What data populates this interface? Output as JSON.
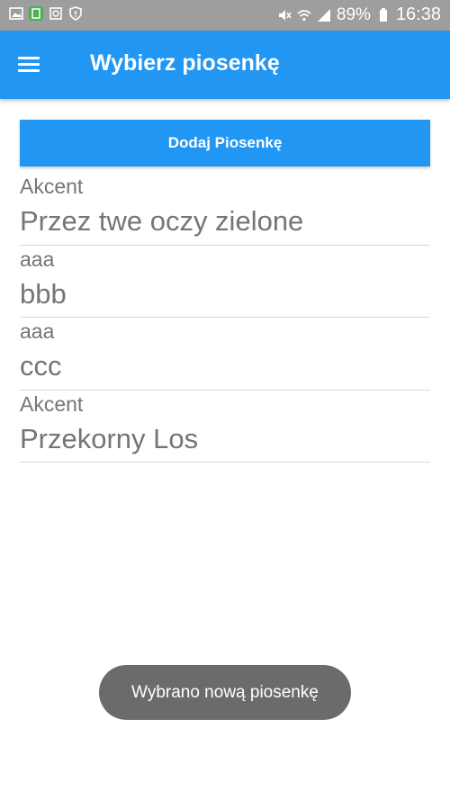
{
  "status_bar": {
    "left_icons": [
      "image-icon",
      "android-debug-icon",
      "recycle-icon",
      "shield-icon"
    ],
    "right_icons": [
      "mute-icon",
      "wifi-icon",
      "signal-icon"
    ],
    "battery": "89%",
    "time": "16:38"
  },
  "app_bar": {
    "menu_icon": "hamburger-menu-icon",
    "title": "Wybierz piosenkę"
  },
  "add_button_label": "Dodaj Piosenkę",
  "songs": [
    {
      "artist": "Akcent",
      "title": "Przez twe oczy zielone"
    },
    {
      "artist": "aaa",
      "title": "bbb"
    },
    {
      "artist": "aaa",
      "title": "ccc"
    },
    {
      "artist": "Akcent",
      "title": "Przekorny Los"
    }
  ],
  "toast": "Wybrano nową piosenkę",
  "colors": {
    "primary": "#2196f3",
    "status_bar": "#9e9e9e",
    "text_secondary": "#757575",
    "toast_bg": "#6b6b6b"
  }
}
